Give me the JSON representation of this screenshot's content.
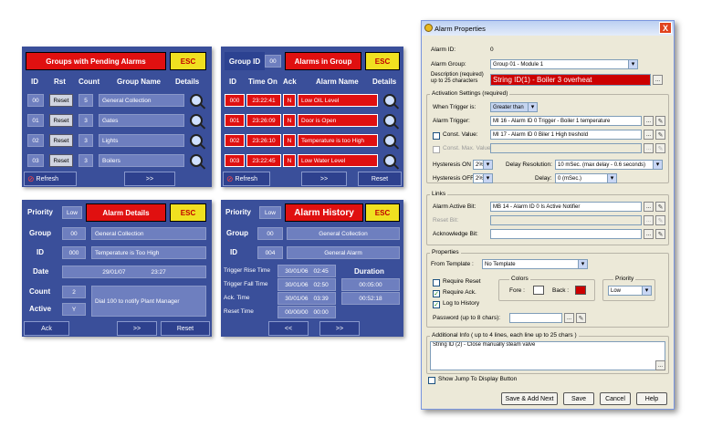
{
  "panel1": {
    "title": "Groups with Pending Alarms",
    "esc": "ESC",
    "headers": [
      "ID",
      "Rst",
      "Count",
      "Group Name",
      "Details"
    ],
    "rows": [
      {
        "id": "00",
        "rst": "Reset",
        "count": "5",
        "name": "General Collection"
      },
      {
        "id": "01",
        "rst": "Reset",
        "count": "3",
        "name": "Gates"
      },
      {
        "id": "02",
        "rst": "Reset",
        "count": "3",
        "name": "Lights"
      },
      {
        "id": "03",
        "rst": "Reset",
        "count": "3",
        "name": "Boilers"
      }
    ],
    "refresh": "Refresh",
    "next": ">>"
  },
  "panel2": {
    "group_label": "Group ID",
    "group_id": "00",
    "title": "Alarms in Group",
    "esc": "ESC",
    "headers": [
      "ID",
      "Time On",
      "Ack",
      "Alarm Name",
      "Details"
    ],
    "rows": [
      {
        "id": "000",
        "time": "23:22:41",
        "ack": "N",
        "name": "Low OIL Level"
      },
      {
        "id": "001",
        "time": "23:26:09",
        "ack": "N",
        "name": "Door is Open"
      },
      {
        "id": "002",
        "time": "23:26:10",
        "ack": "N",
        "name": "Temperature is too High"
      },
      {
        "id": "003",
        "time": "23:22:45",
        "ack": "N",
        "name": "Low Water Level"
      }
    ],
    "refresh": "Refresh",
    "next": ">>",
    "reset": "Reset"
  },
  "panel3": {
    "priority_label": "Priority",
    "priority": "Low",
    "title": "Alarm Details",
    "esc": "ESC",
    "group_label": "Group",
    "group_id": "00",
    "group_name": "General Collection",
    "id_label": "ID",
    "id": "000",
    "alarm_name": "Temperature is Too High",
    "date_label": "Date",
    "date": "29/01/07",
    "time": "23:27",
    "count_label": "Count",
    "count": "2",
    "active_label": "Active",
    "active": "Y",
    "info": "Dial 100 to notify Plant Manager",
    "ack": "Ack",
    "next": ">>",
    "reset": "Reset"
  },
  "panel4": {
    "priority_label": "Priority",
    "priority": "Low",
    "title": "Alarm History",
    "esc": "ESC",
    "group_label": "Group",
    "group_id": "00",
    "group_name": "General Collection",
    "id_label": "ID",
    "id": "004",
    "alarm_name": "General Alarm",
    "duration_label": "Duration",
    "rows": [
      {
        "label": "Trigger Rise Time",
        "date": "30/01/06",
        "time": "02:45",
        "dur": ""
      },
      {
        "label": "Trigger Fall Time",
        "date": "30/01/06",
        "time": "02:50",
        "dur": "00:05:00"
      },
      {
        "label": "Ack. Time",
        "date": "30/01/06",
        "time": "03:39",
        "dur": "00:52:18"
      },
      {
        "label": "Reset Time",
        "date": "00/00/00",
        "time": "00:00",
        "dur": ""
      }
    ],
    "prev": "<<",
    "next": ">>"
  },
  "dialog": {
    "title": "Alarm Properties",
    "close": "X",
    "alarm_id_label": "Alarm ID:",
    "alarm_id": "0",
    "alarm_group_label": "Alarm Group:",
    "alarm_group": "Group 01 - Module 1",
    "desc_label": "Description (required) up to 25 characters",
    "desc": "String ID(1) - Boiler 3 overheat",
    "activation": {
      "legend": "Activation Settings (required)",
      "when_label": "When Trigger is:",
      "when": "Greater than",
      "trigger_label": "Alarm Trigger:",
      "trigger": "MI 16 - Alarm ID 0 Trigger - Boiler 1 temperature",
      "const_label": "Const. Value:",
      "const": "MI 17 - Alarm ID 0 Biler 1 High treshold",
      "const_max_label": "Const. Max. Value:",
      "hyst_on_label": "Hysteresis ON",
      "hyst_on": "2%",
      "delay_res_label": "Delay Resolution:",
      "delay_res": "10 mSec.  (max delay - 0.6 seconds)",
      "hyst_off_label": "Hysteresis OFF",
      "hyst_off": "2%",
      "delay_label": "Delay:",
      "delay": "0   (mSec.)"
    },
    "links": {
      "legend": "Links",
      "active_label": "Alarm Active Bit:",
      "active": "MB 14 - Alarm ID 0 Is Active Notifier",
      "reset_label": "Reset Bit:",
      "ack_label": "Acknowledge Bit:"
    },
    "props": {
      "legend": "Properties",
      "template_label": "From Template :",
      "template": "No Template",
      "req_reset": "Require Reset",
      "req_ack": "Require Ack.",
      "log": "Log to History",
      "colors_legend": "Colors",
      "fore": "Fore :",
      "back": "Back :",
      "priority_legend": "Priority",
      "priority": "Low",
      "password_label": "Password (up to 8 chars):",
      "back_color": "#cc0000"
    },
    "info": {
      "legend": "Additional Info ( up to 4 lines, each line up to 25 chars )",
      "text": "String ID (2) - Close manually steam valve"
    },
    "show_jump": "Show Jump To Display Button",
    "buttons": {
      "save_add": "Save & Add Next",
      "save": "Save",
      "cancel": "Cancel",
      "help": "Help"
    }
  }
}
